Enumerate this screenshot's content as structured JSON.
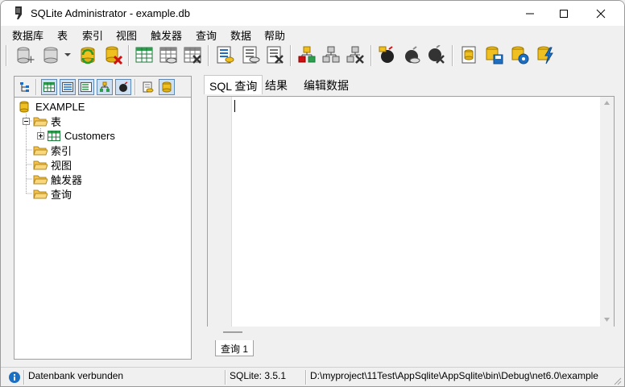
{
  "window": {
    "title": "SQLite Administrator - example.db"
  },
  "menu": [
    "数据库",
    "表",
    "索引",
    "视图",
    "触发器",
    "查询",
    "数据",
    "帮助"
  ],
  "toolbar": {
    "icons": [
      "new-database-icon",
      "open-database-icon",
      "dropdown-arrow-icon",
      "refresh-database-icon",
      "close-database-icon",
      "new-table-icon",
      "edit-table-icon",
      "drop-table-icon",
      "new-index-icon",
      "edit-index-icon",
      "drop-index-icon",
      "new-view-icon",
      "edit-view-icon",
      "drop-view-icon",
      "new-trigger-icon",
      "edit-trigger-icon",
      "drop-trigger-icon",
      "database-info-icon",
      "save-database-icon",
      "settings-icon",
      "execute-icon"
    ]
  },
  "left_panel": {
    "tree": {
      "root": "EXAMPLE",
      "nodes": [
        {
          "label": "表",
          "expanded": true,
          "children": [
            "Customers"
          ]
        },
        {
          "label": "索引"
        },
        {
          "label": "视图"
        },
        {
          "label": "触发器"
        },
        {
          "label": "查询"
        }
      ]
    }
  },
  "tabs": [
    "SQL 查询",
    "结果",
    "编辑数据"
  ],
  "editor": {
    "content": ""
  },
  "query_tab": "查询 1",
  "status": {
    "message": "Datenbank verbunden",
    "version": "SQLite: 3.5.1",
    "path": "D:\\myproject\\11Test\\AppSqlite\\AppSqlite\\bin\\Debug\\net6.0\\example"
  },
  "colors": {
    "accent": "#1c6fc2",
    "folder": "#f4c24d",
    "db": "#f0c020"
  }
}
